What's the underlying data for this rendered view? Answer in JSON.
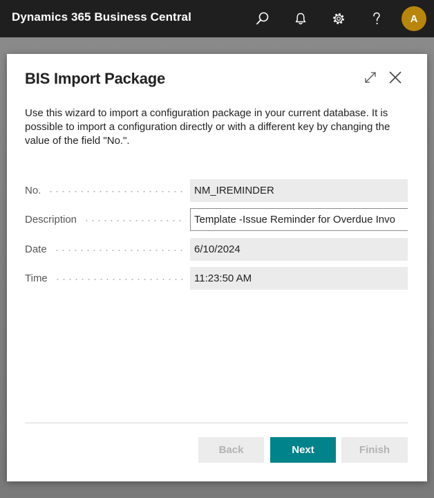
{
  "header": {
    "app_title": "Dynamics 365 Business Central",
    "avatar_initial": "A",
    "icons": [
      "search-icon",
      "bell-icon",
      "gear-icon",
      "help-icon"
    ]
  },
  "dialog": {
    "title": "BIS Import Package",
    "intro": "Use this wizard to import a configuration package in your current database. It is possible to import a configuration directly or with a different key by changing the value of the field \"No.\".",
    "fields": [
      {
        "label": "No.",
        "value": "NM_IREMINDER"
      },
      {
        "label": "Description",
        "value": "Template -Issue Reminder for Overdue Invo"
      },
      {
        "label": "Date",
        "value": "6/10/2024"
      },
      {
        "label": "Time",
        "value": "11:23:50 AM"
      }
    ],
    "buttons": {
      "back": "Back",
      "next": "Next",
      "finish": "Finish"
    }
  },
  "colors": {
    "topbar": "#1f1f1f",
    "accent": "#00838a",
    "avatar": "#b8860b"
  }
}
